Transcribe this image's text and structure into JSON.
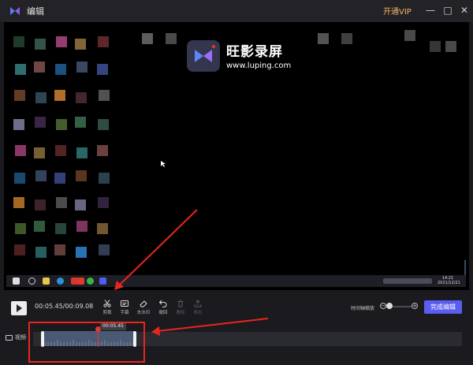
{
  "window": {
    "title": "编辑",
    "vip_label": "开通VIP",
    "minimize_glyph": "—",
    "maximize_glyph": "□",
    "close_glyph": "✕"
  },
  "preview": {
    "brand_name": "旺影录屏",
    "brand_url": "www.luping.com",
    "clock": [
      "14:21",
      "2021/12/21"
    ]
  },
  "player": {
    "time_display": "00:05.45/00:09.08"
  },
  "tools": [
    {
      "label": "剪裁",
      "icon": "scissors-icon",
      "enabled": true
    },
    {
      "label": "字幕",
      "icon": "subtitle-icon",
      "enabled": true
    },
    {
      "label": "去水印",
      "icon": "eraser-icon",
      "enabled": true
    },
    {
      "label": "撤回",
      "icon": "undo-icon",
      "enabled": true
    },
    {
      "label": "删除",
      "icon": "delete-icon",
      "enabled": false
    },
    {
      "label": "导出",
      "icon": "export-icon",
      "enabled": false
    }
  ],
  "zoom": {
    "label": "时间轴缩放",
    "minus": "−",
    "plus": "+",
    "level": 0
  },
  "finish_button": "完成编辑",
  "timeline": {
    "track_label": "视频",
    "playhead_time": "00:05.45",
    "playhead_position_seconds": 5.45,
    "duration_seconds": 9.08
  },
  "colors": {
    "accent": "#5a5ef0",
    "vip": "#f2b26b",
    "playhead": "#e33333",
    "annotation": "#e8261c",
    "clip": "#4b5a74"
  }
}
